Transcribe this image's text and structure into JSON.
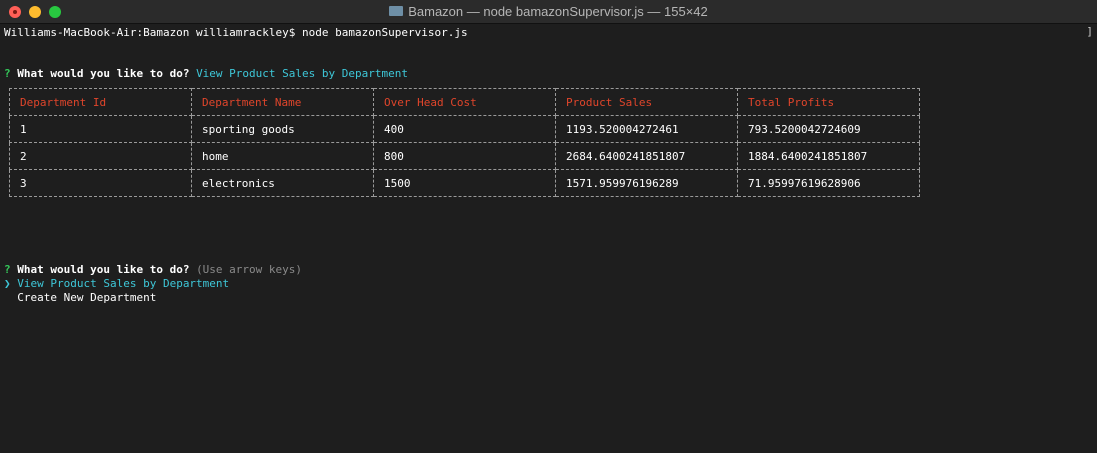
{
  "window": {
    "title": "Bamazon — node bamazonSupervisor.js — 155×42"
  },
  "terminal": {
    "command_line": "Williams-MacBook-Air:Bamazon williamrackley$ node bamazonSupervisor.js",
    "prompt1": {
      "marker": "?",
      "question": "What would you like to do?",
      "answer": "View Product Sales by Department"
    },
    "table": {
      "headers": [
        "Department Id",
        "Department Name",
        "Over Head Cost",
        "Product Sales",
        "Total Profits"
      ],
      "rows": [
        [
          "1",
          "sporting goods",
          "400",
          "1193.520004272461",
          "793.5200042724609"
        ],
        [
          "2",
          "home",
          "800",
          "2684.6400241851807",
          "1884.6400241851807"
        ],
        [
          "3",
          "electronics",
          "1500",
          "1571.959976196289",
          "71.95997619628906"
        ]
      ]
    },
    "prompt2": {
      "marker": "?",
      "question": "What would you like to do?",
      "hint": "(Use arrow keys)",
      "pointer": "❯",
      "options": [
        "View Product Sales by Department",
        "Create New Department"
      ]
    }
  },
  "colors": {
    "background": "#1e1e1e",
    "header_text": "#e0452b",
    "selected": "#3ec7d8",
    "prompt_marker": "#34c759"
  }
}
